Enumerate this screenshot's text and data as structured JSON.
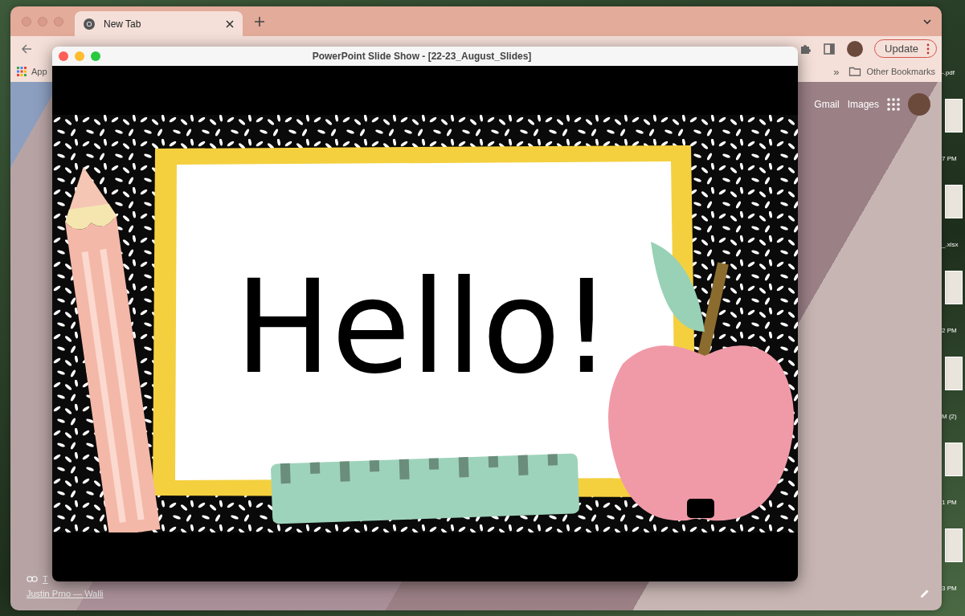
{
  "browser": {
    "tabs": [
      {
        "label": "New Tab",
        "selected": true
      }
    ],
    "bookmarks": {
      "apps_label": "App",
      "overflow": "»",
      "folder": "Other Bookmarks"
    },
    "update_button": "Update",
    "new_tab_page": {
      "links": [
        "Gmail",
        "Images"
      ],
      "shortcut_label": "T",
      "photo_credit": "Justin Prno — Walli"
    }
  },
  "slideshow": {
    "title": "PowerPoint Slide Show - [22-23_August_Slides]",
    "slide_text": "Hello!"
  },
  "desktop_files": [
    {
      "label": "-.pdf"
    },
    {
      "label": "7 PM"
    },
    {
      "label": "_.xlsx"
    },
    {
      "label": "2 PM"
    },
    {
      "label": "M (2)"
    },
    {
      "label": "1 PM"
    },
    {
      "label": "3 PM"
    }
  ]
}
